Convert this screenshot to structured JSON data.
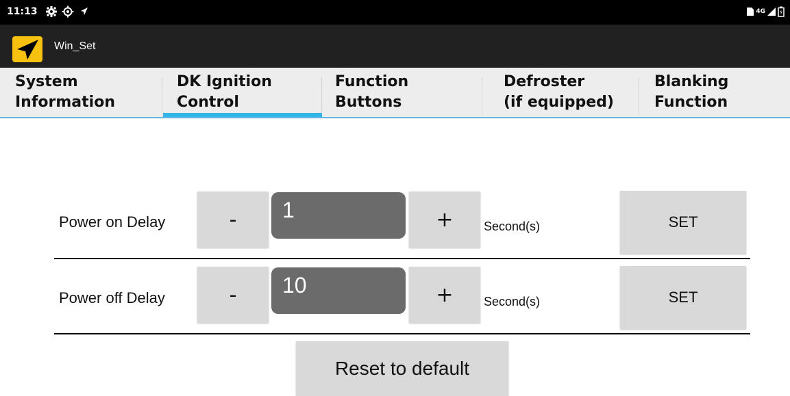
{
  "status_bar": {
    "time": "11:13",
    "network_label": "4G",
    "icons": [
      "settings-icon",
      "gps-icon",
      "location-arrow-icon",
      "sim-card-icon",
      "signal-icon",
      "battery-icon"
    ]
  },
  "app_bar": {
    "title": "Win_Set",
    "icon": "navigation-arrow-icon",
    "icon_color": "#F7C20F"
  },
  "tabs": [
    {
      "line1": "System",
      "line2": "Information",
      "selected": false
    },
    {
      "line1": "DK Ignition",
      "line2": "Control",
      "selected": true
    },
    {
      "line1": "Function",
      "line2": "Buttons",
      "selected": false
    },
    {
      "line1": "Defroster",
      "line2": "(if equipped)",
      "selected": false
    },
    {
      "line1": "Blanking",
      "line2": "Function",
      "selected": false
    }
  ],
  "accent_color": "#33B5E5",
  "settings": [
    {
      "label": "Power on Delay",
      "minus_label": "-",
      "value": "1",
      "plus_label": "+",
      "unit": "Second(s)",
      "set_label": "SET"
    },
    {
      "label": "Power off Delay",
      "minus_label": "-",
      "value": "10",
      "plus_label": "+",
      "unit": "Second(s)",
      "set_label": "SET"
    }
  ],
  "reset_label": "Reset to default"
}
